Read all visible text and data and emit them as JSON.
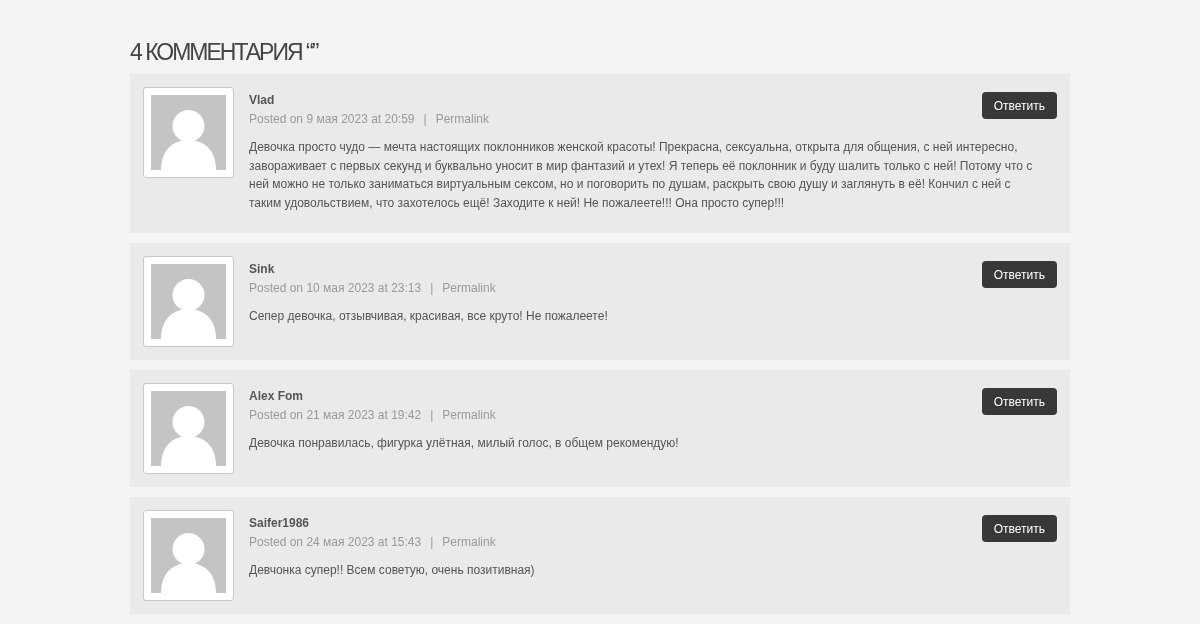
{
  "heading": "4 КОММЕНТАРИЯ “”",
  "comments": [
    {
      "author": "Vlad",
      "posted": "Posted on 9 мая 2023 at 20:59",
      "separator": "|",
      "permalink": "Permalink",
      "reply": "Ответить",
      "text": "Девочка просто чудо — мечта настоящих поклонников женской красоты! Прекрасна, сексуальна, открыта для общения, с ней интересно, завораживает с первых секунд и буквально уносит в мир фантазий и утех! Я теперь её поклонник и буду шалить только с ней! Потому что с ней можно не только заниматься виртуальным сексом, но и поговорить по душам, раскрыть свою душу и заглянуть в её! Кончил с ней с таким удовольствием, что захотелось ещё! Заходите к ней! Не пожалеете!!! Она просто супер!!!"
    },
    {
      "author": "Sink",
      "posted": "Posted on 10 мая 2023 at 23:13",
      "separator": "|",
      "permalink": "Permalink",
      "reply": "Ответить",
      "text": "Сепер девочка, отзывчивая, красивая, все круто! Не пожалеете!"
    },
    {
      "author": "Alex Fom",
      "posted": "Posted on 21 мая 2023 at 19:42",
      "separator": "|",
      "permalink": "Permalink",
      "reply": "Ответить",
      "text": "Девочка понравилась, фигурка улётная, милый голос, в общем рекомендую!"
    },
    {
      "author": "Saifer1986",
      "posted": "Posted on 24 мая 2023 at 15:43",
      "separator": "|",
      "permalink": "Permalink",
      "reply": "Ответить",
      "text": "Девчонка супер!! Всем советую, очень позитивная)"
    }
  ]
}
